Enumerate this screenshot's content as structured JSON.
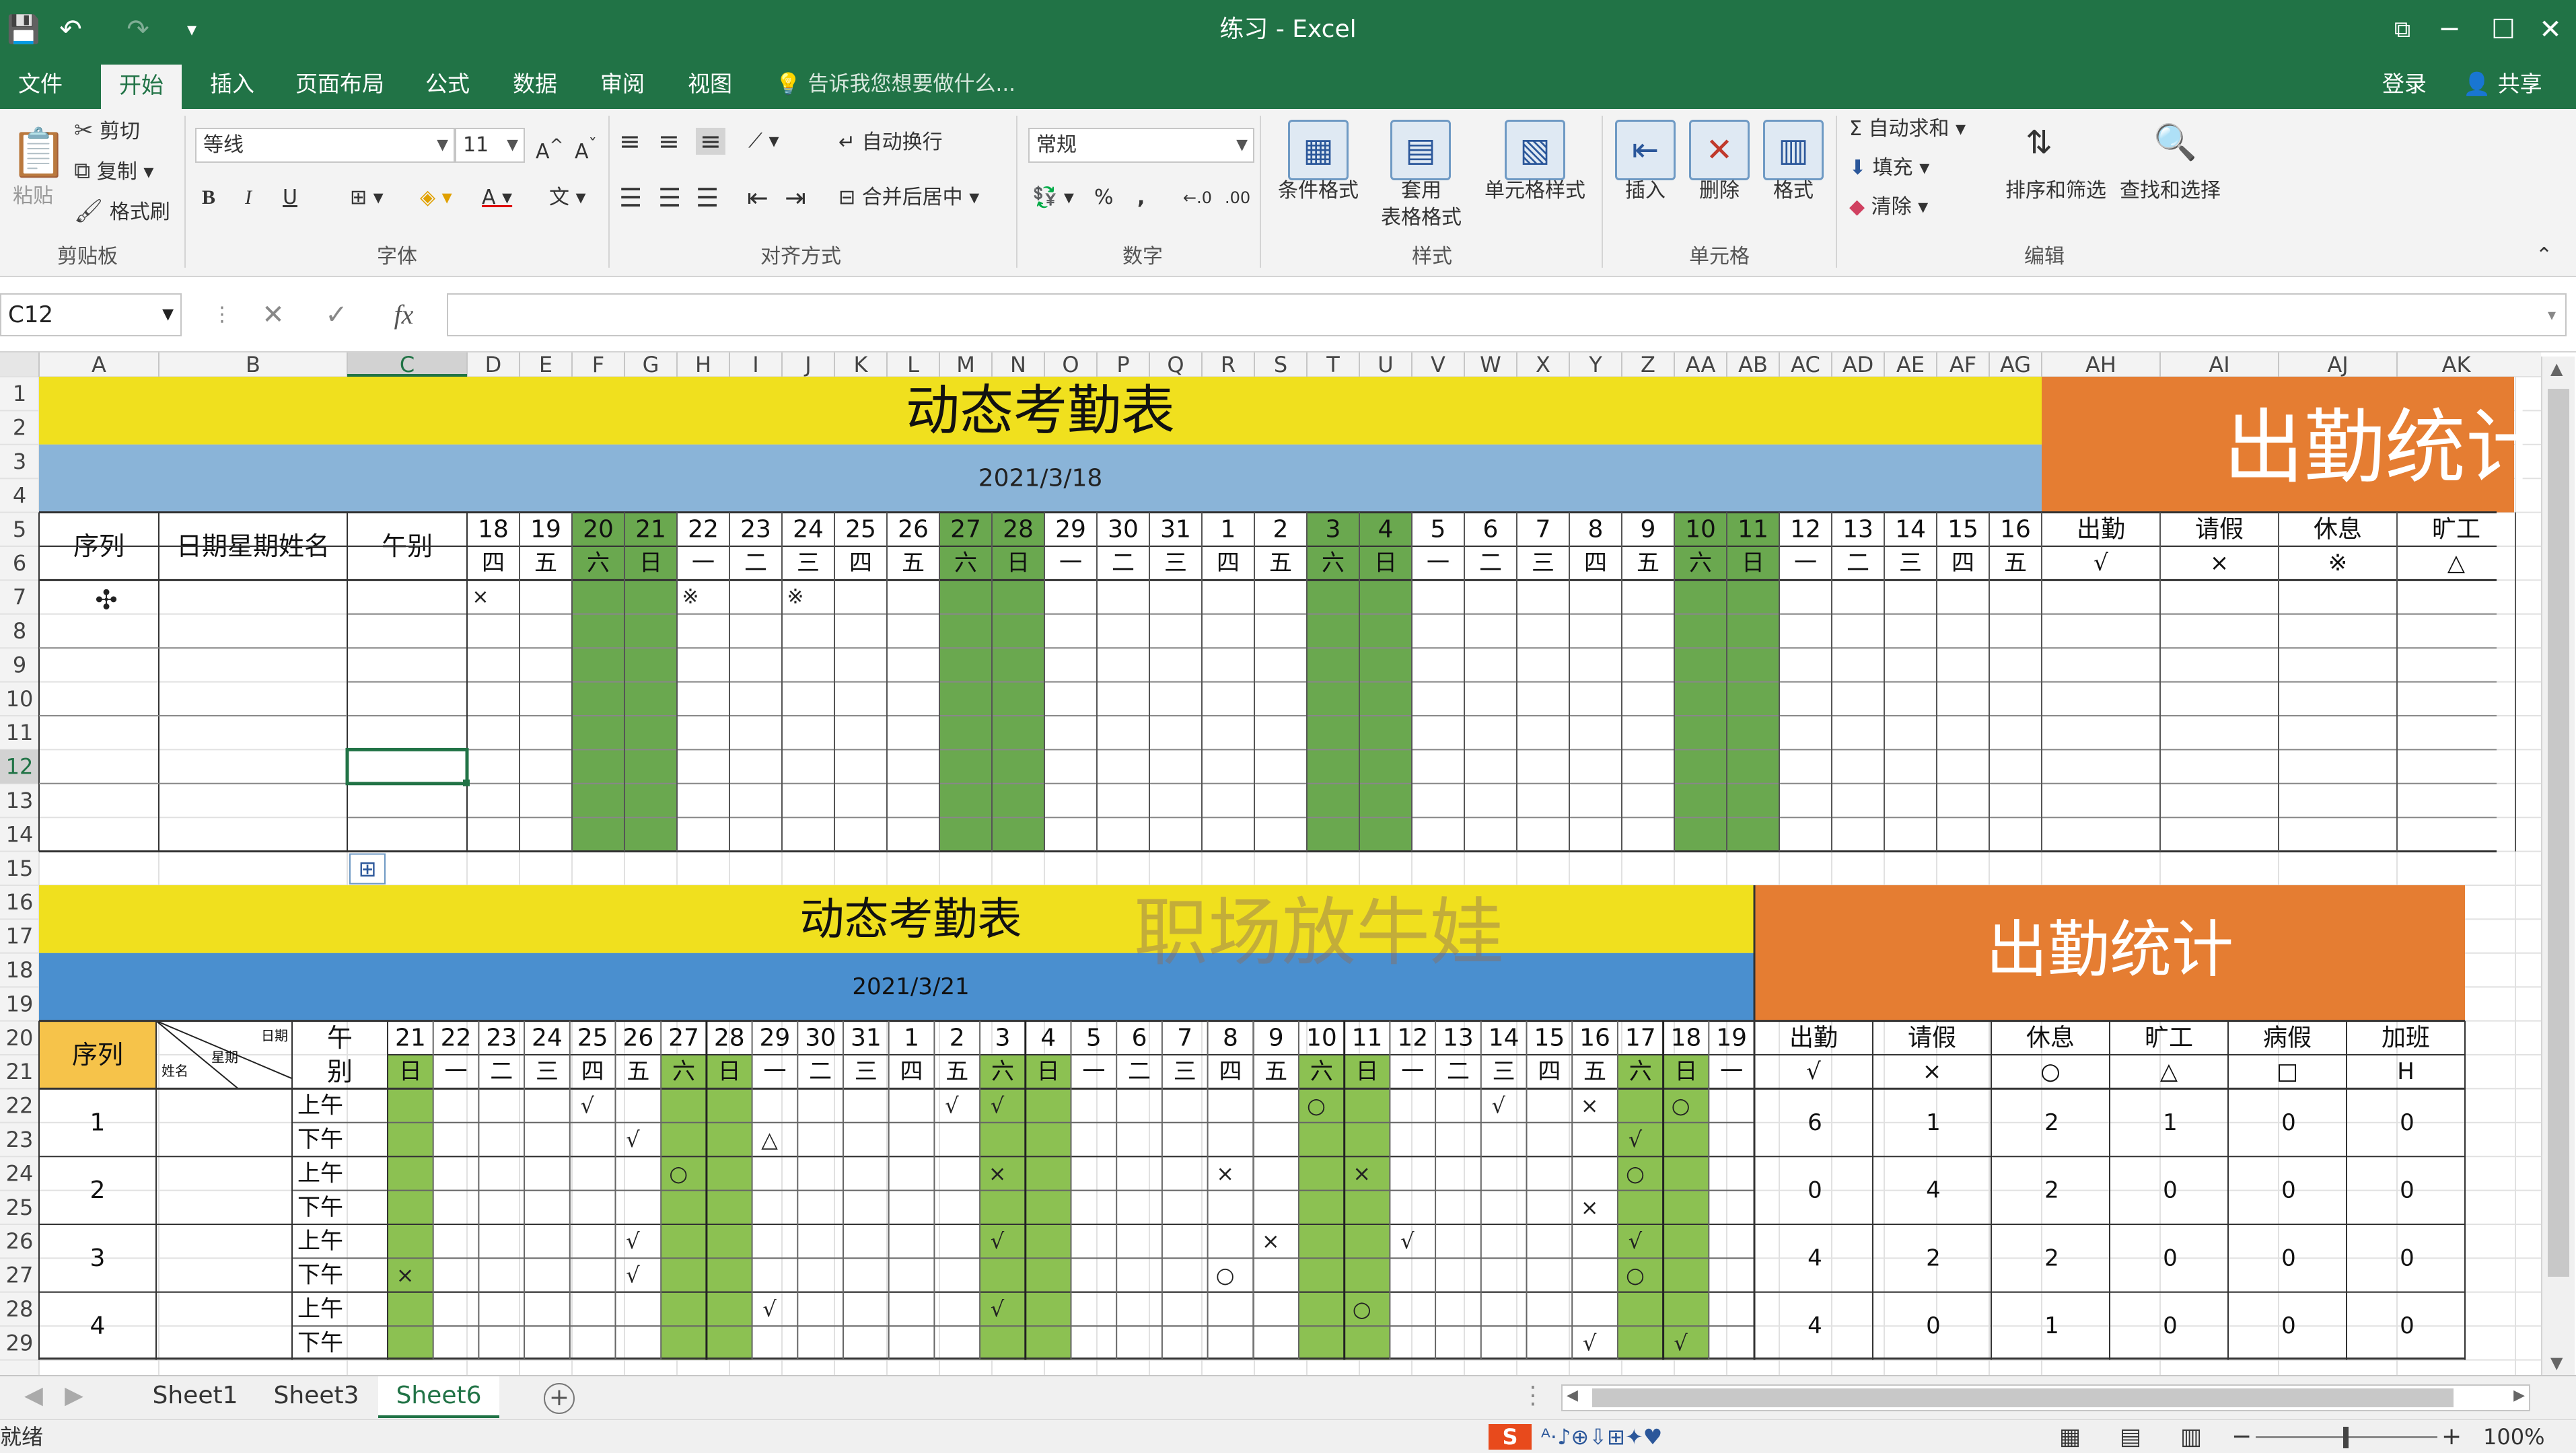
{
  "window": {
    "title": "练习 - Excel",
    "quick_access": [
      "save-icon",
      "undo-icon",
      "redo-icon",
      "customize-icon"
    ]
  },
  "ribbon_tabs": [
    "文件",
    "开始",
    "插入",
    "页面布局",
    "公式",
    "数据",
    "审阅",
    "视图"
  ],
  "active_tab": "开始",
  "tell_me": "告诉我您想要做什么...",
  "account": {
    "login": "登录",
    "share": "共享"
  },
  "clipboard": {
    "paste": "粘贴",
    "cut": "剪切",
    "copy": "复制",
    "format_painter": "格式刷",
    "group": "剪贴板"
  },
  "font": {
    "name": "等线",
    "size": "11",
    "bold": "B",
    "italic": "I",
    "underline": "U",
    "group": "字体"
  },
  "alignment": {
    "wrap": "自动换行",
    "merge": "合并后居中",
    "group": "对齐方式"
  },
  "number": {
    "format": "常规",
    "percent": "%",
    "comma": ",",
    "group": "数字"
  },
  "styles": {
    "conditional": "条件格式",
    "table": [
      "套用",
      "表格格式"
    ],
    "cell_styles": "单元格样式",
    "group": "样式"
  },
  "cells": {
    "insert": "插入",
    "delete": "删除",
    "format": "格式",
    "group": "单元格"
  },
  "editing": {
    "autosum": "自动求和",
    "fill": "填充",
    "clear": "清除",
    "sort": "排序和筛选",
    "find": "查找和选择",
    "group": "编辑"
  },
  "formula_bar": {
    "name_box": "C12",
    "cancel": "✕",
    "enter": "✓",
    "fx": "fx",
    "value": ""
  },
  "columns": [
    "A",
    "B",
    "C",
    "D",
    "E",
    "F",
    "G",
    "H",
    "I",
    "J",
    "K",
    "L",
    "M",
    "N",
    "O",
    "P",
    "Q",
    "R",
    "S",
    "T",
    "U",
    "V",
    "W",
    "X",
    "Y",
    "Z",
    "AA",
    "AB",
    "AC",
    "AD",
    "AE",
    "AF",
    "AG",
    "AH",
    "AI",
    "AJ",
    "AK"
  ],
  "rows": [
    "1",
    "2",
    "3",
    "4",
    "5",
    "6",
    "7",
    "8",
    "9",
    "10",
    "11",
    "12",
    "13",
    "14",
    "15",
    "16",
    "17",
    "18",
    "19",
    "20",
    "21",
    "22",
    "23",
    "24",
    "25",
    "26",
    "27",
    "28",
    "29"
  ],
  "table1": {
    "title": "动态考勤表",
    "date": "2021/3/18",
    "stat_title": "出勤统计",
    "headers": {
      "seq": "序列",
      "name": "日期星期姓名",
      "ampm": "午别"
    },
    "days": [
      "18",
      "19",
      "20",
      "21",
      "22",
      "23",
      "24",
      "25",
      "26",
      "27",
      "28",
      "29",
      "30",
      "31",
      "1",
      "2",
      "3",
      "4",
      "5",
      "6",
      "7",
      "8",
      "9",
      "10",
      "11",
      "12",
      "13",
      "14",
      "15",
      "16"
    ],
    "weekdays": [
      "四",
      "五",
      "六",
      "日",
      "一",
      "二",
      "三",
      "四",
      "五",
      "六",
      "日",
      "一",
      "二",
      "三",
      "四",
      "五",
      "六",
      "日",
      "一",
      "二",
      "三",
      "四",
      "五",
      "六",
      "日",
      "一",
      "二",
      "三",
      "四",
      "五"
    ],
    "stat_labels": [
      "出勤",
      "请假",
      "休息",
      "旷工"
    ],
    "stat_symbols": [
      "√",
      "×",
      "※",
      "△"
    ],
    "row7_marks": [
      {
        "day": 0,
        "mark": "×"
      },
      {
        "day": 4,
        "mark": "※"
      },
      {
        "day": 6,
        "mark": "※"
      }
    ]
  },
  "table2": {
    "title": "动态考勤表",
    "date": "2021/3/21",
    "stat_title": "出勤统计",
    "headers": {
      "seq": "序列",
      "date_lbl": "日期",
      "week_lbl": "星期",
      "name_lbl": "姓名",
      "ampm": [
        "午",
        "别"
      ]
    },
    "days": [
      "21",
      "22",
      "23",
      "24",
      "25",
      "26",
      "27",
      "28",
      "29",
      "30",
      "31",
      "1",
      "2",
      "3",
      "4",
      "5",
      "6",
      "7",
      "8",
      "9",
      "10",
      "11",
      "12",
      "13",
      "14",
      "15",
      "16",
      "17",
      "18",
      "19"
    ],
    "weekdays": [
      "日",
      "一",
      "二",
      "三",
      "四",
      "五",
      "六",
      "日",
      "一",
      "二",
      "三",
      "四",
      "五",
      "六",
      "日",
      "一",
      "二",
      "三",
      "四",
      "五",
      "六",
      "日",
      "一",
      "二",
      "三",
      "四",
      "五",
      "六",
      "日",
      "一"
    ],
    "stat_labels": [
      "出勤",
      "请假",
      "休息",
      "旷工",
      "病假",
      "加班"
    ],
    "stat_symbols": [
      "√",
      "×",
      "○",
      "△",
      "□",
      "H"
    ],
    "people": [
      {
        "seq": "1",
        "am": {
          "4": "√",
          "12": "√",
          "13": "√",
          "20": "○",
          "24": "√",
          "26": "×",
          "28": "○"
        },
        "pm": {
          "5": "√",
          "8": "△",
          "27": "√"
        },
        "stats": [
          "6",
          "1",
          "2",
          "1",
          "0",
          "0"
        ]
      },
      {
        "seq": "2",
        "am": {
          "6": "○",
          "13": "×",
          "18": "×",
          "21": "×",
          "27": "○"
        },
        "pm": {
          "26": "×"
        },
        "stats": [
          "0",
          "4",
          "2",
          "0",
          "0",
          "0"
        ]
      },
      {
        "seq": "3",
        "am": {
          "5": "√",
          "13": "√",
          "19": "×",
          "22": "√",
          "27": "√"
        },
        "pm": {
          "0": "×",
          "5": "√",
          "18": "○",
          "27": "○"
        },
        "stats": [
          "4",
          "2",
          "2",
          "0",
          "0",
          "0"
        ]
      },
      {
        "seq": "4",
        "am": {
          "8": "√",
          "13": "√",
          "21": "○"
        },
        "pm": {
          "26": "√",
          "28": "√"
        },
        "stats": [
          "4",
          "0",
          "1",
          "0",
          "0",
          "0"
        ]
      }
    ],
    "am_label": "上午",
    "pm_label": "下午"
  },
  "watermark": "职场放牛娃",
  "sheets": [
    "Sheet1",
    "Sheet3",
    "Sheet6"
  ],
  "active_sheet": "Sheet6",
  "status": {
    "ready": "就绪",
    "zoom": "100%"
  },
  "colors": {
    "excel_green": "#217346",
    "title_yellow": "#f0e01e",
    "date_blue": "#8ab4d8",
    "date_blue2": "#4a8fcf",
    "stat_orange": "#e57d32",
    "weekend_green": "#6aa84f",
    "weekend_green2": "#8cc152",
    "header_gold": "#f6c34a"
  }
}
